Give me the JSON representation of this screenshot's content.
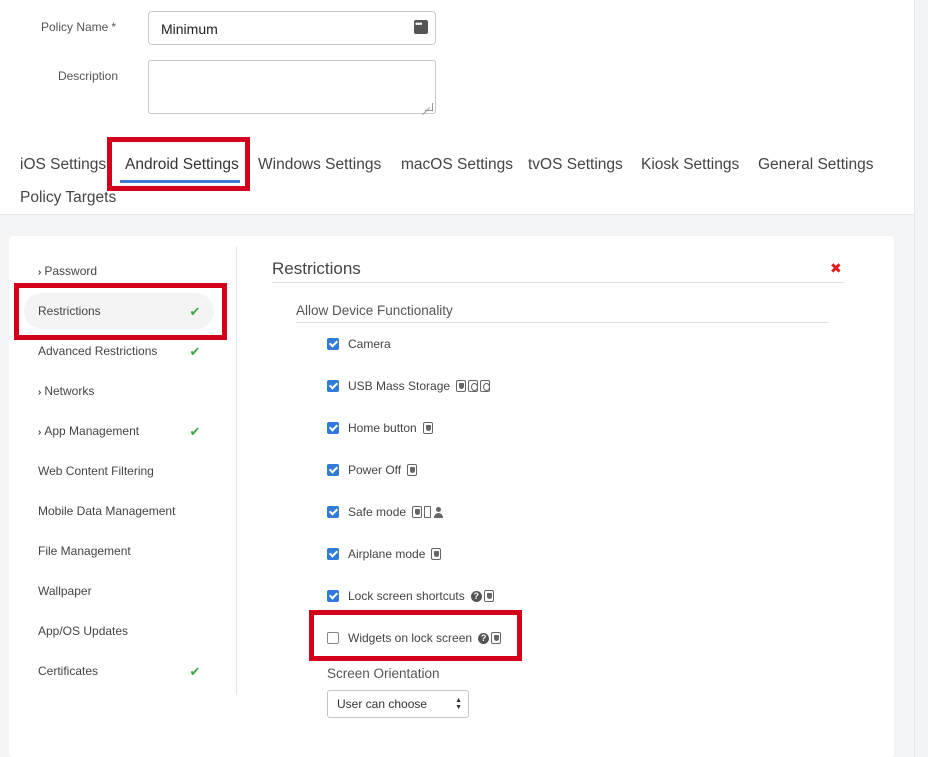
{
  "form": {
    "policy_name_label": "Policy Name",
    "required_mark": "*",
    "policy_name_value": "Minimum",
    "description_label": "Description",
    "description_value": ""
  },
  "tabs": [
    {
      "label": "iOS Settings"
    },
    {
      "label": "Android Settings"
    },
    {
      "label": "Windows Settings"
    },
    {
      "label": "macOS Settings"
    },
    {
      "label": "tvOS Settings"
    },
    {
      "label": "Kiosk Settings"
    },
    {
      "label": "General Settings"
    },
    {
      "label": "Policy Targets"
    }
  ],
  "sidebar": {
    "items": [
      {
        "label": "Password",
        "has_chevron": true,
        "checked": false
      },
      {
        "label": "Restrictions",
        "has_chevron": false,
        "checked": true
      },
      {
        "label": "Advanced Restrictions",
        "has_chevron": false,
        "checked": true
      },
      {
        "label": "Networks",
        "has_chevron": true,
        "checked": false
      },
      {
        "label": "App Management",
        "has_chevron": true,
        "checked": true
      },
      {
        "label": "Web Content Filtering",
        "has_chevron": false,
        "checked": false
      },
      {
        "label": "Mobile Data Management",
        "has_chevron": false,
        "checked": false
      },
      {
        "label": "File Management",
        "has_chevron": false,
        "checked": false
      },
      {
        "label": "Wallpaper",
        "has_chevron": false,
        "checked": false
      },
      {
        "label": "App/OS Updates",
        "has_chevron": false,
        "checked": false
      },
      {
        "label": "Certificates",
        "has_chevron": false,
        "checked": true
      }
    ]
  },
  "main": {
    "section_title": "Restrictions",
    "close_symbol": "✖",
    "group_title": "Allow Device Functionality",
    "options": [
      {
        "label": "Camera",
        "checked": true,
        "icons": []
      },
      {
        "label": "USB Mass Storage",
        "checked": true,
        "icons": [
          "shield-icon",
          "tag-icon",
          "tag-icon"
        ]
      },
      {
        "label": "Home button",
        "checked": true,
        "icons": [
          "shield-icon"
        ]
      },
      {
        "label": "Power Off",
        "checked": true,
        "icons": [
          "shield-icon"
        ]
      },
      {
        "label": "Safe mode",
        "checked": true,
        "icons": [
          "shield-icon",
          "phone-icon",
          "person-icon"
        ]
      },
      {
        "label": "Airplane mode",
        "checked": true,
        "icons": [
          "shield-icon"
        ]
      },
      {
        "label": "Lock screen shortcuts",
        "checked": true,
        "icons": [
          "help-icon",
          "shield-icon"
        ]
      },
      {
        "label": "Widgets on lock screen",
        "checked": false,
        "icons": [
          "help-icon",
          "shield-icon"
        ]
      }
    ],
    "orientation_label": "Screen Orientation",
    "orientation_value": "User can choose"
  },
  "colors": {
    "accent": "#3f7bd6",
    "checkbox": "#2f7bd8",
    "highlight": "#d3001b",
    "success": "#3aa845",
    "danger": "#e02020"
  }
}
